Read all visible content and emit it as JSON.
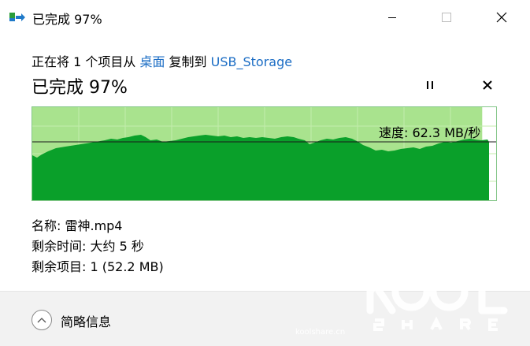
{
  "window": {
    "title": "已完成 97%",
    "controls": [
      "minimize",
      "maximize",
      "close"
    ]
  },
  "copy": {
    "line_prefix": "正在将 1 个项目从 ",
    "source": "桌面",
    "line_middle": " 复制到 ",
    "destination": "USB_Storage"
  },
  "progress": {
    "status": "已完成 97%",
    "percent": 97
  },
  "graph": {
    "speed_label": "速度: 62.3 MB/秒"
  },
  "details": {
    "name_label": "名称: 雷神.mp4",
    "time_remaining": "剩余时间: 大约 5 秒",
    "items_remaining": "剩余项目: 1 (52.2 MB)"
  },
  "footer": {
    "expand_label": "简略信息"
  },
  "watermark": {
    "brand": "KOOL SHARE",
    "site": "koolshare.cn"
  },
  "colors": {
    "accent_link": "#1a6cc4",
    "progress_fill": "#a9e38e",
    "speed_fill": "#0aa02a",
    "footer_bg": "#f2f2f2"
  }
}
